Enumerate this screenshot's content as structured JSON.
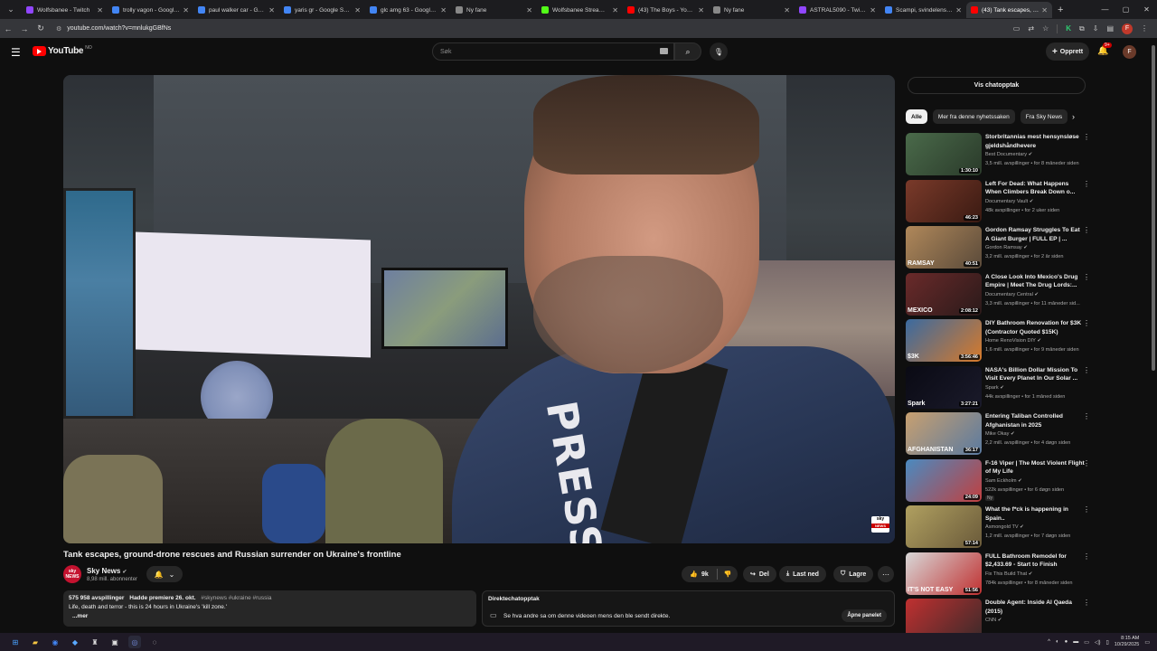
{
  "browser": {
    "tabs": [
      {
        "title": "Wolfsbanee - Twitch",
        "color": "#9146ff"
      },
      {
        "title": "trolly vagon - Google Search",
        "color": "#4285f4"
      },
      {
        "title": "paul walker car - Google Search",
        "color": "#4285f4"
      },
      {
        "title": "yaris gr - Google Search",
        "color": "#4285f4"
      },
      {
        "title": "glc amg 63 - Google Search",
        "color": "#4285f4"
      },
      {
        "title": "Ny fane",
        "color": "#888888"
      },
      {
        "title": "Wolfsbanee Stream - Kick",
        "color": "#53fc18"
      },
      {
        "title": "(43) The Boys - YouTube",
        "color": "#ff0000"
      },
      {
        "title": "Ny fane",
        "color": "#888888"
      },
      {
        "title": "ASTRAL5090 - Twitch",
        "color": "#9146ff"
      },
      {
        "title": "Scampi, svindelens opp...",
        "color": "#4285f4"
      },
      {
        "title": "(43) Tank escapes, gro...",
        "color": "#ff0000",
        "active": true
      }
    ],
    "url": "youtube.com/watch?v=mnlukgGBfNs",
    "profile_letter": "F"
  },
  "youtube": {
    "logo_word": "YouTube",
    "region": "NO",
    "search_placeholder": "Søk",
    "create_label": "Opprett",
    "notif_count": "9+",
    "avatar_letter": "F"
  },
  "video": {
    "title": "Tank escapes, ground-drone rescues and Russian surrender on Ukraine's frontline",
    "channel": "Sky News",
    "subscribers": "8,98 mill. abonnenter",
    "likes": "9k",
    "share_label": "Del",
    "download_label": "Last ned",
    "save_label": "Lagre",
    "watermark_top": "sky",
    "watermark_bottom": "NEWS",
    "press_text": "PRESS"
  },
  "description": {
    "views": "575 958 avspillinger",
    "premiere": "Hadde premiere 26. okt.",
    "tags": "#skynews #ukraine #russia",
    "line2": "Life, death and terror - this is 24 hours in Ukraine's 'kill zone.'",
    "more": "...mer"
  },
  "livechat": {
    "heading": "Direktechatopptak",
    "message": "Se hva andre sa om denne videoen mens den ble sendt direkte.",
    "open_label": "Åpne panelet"
  },
  "sidebar": {
    "chat_replay": "Vis chatopptak",
    "chips": [
      "Alle",
      "Mer fra denne nyhetssaken",
      "Fra Sky News"
    ],
    "recommendations": [
      {
        "title": "Storbritannias mest hensynsløse gjeldshåndhevere",
        "channel": "Best Documentary",
        "stats": "3,5 mill. avspillinger • for 8 måneder siden",
        "duration": "1:30:10",
        "c1": "#4a6a4a",
        "c2": "#2a3a2a"
      },
      {
        "title": "Left For Dead: What Happens When Climbers Break Down o...",
        "channel": "Documentary Vault",
        "stats": "48k avspillinger • for 2 uker siden",
        "duration": "46:23",
        "c1": "#7a3a2a",
        "c2": "#3a1a12"
      },
      {
        "title": "Gordon Ramsay Struggles To Eat A Giant Burger | FULL EP | ...",
        "channel": "Gordon Ramsay",
        "stats": "3,2 mill. avspillinger • for 2 år siden",
        "duration": "40:51",
        "c1": "#b0885a",
        "c2": "#5a4a3a",
        "label": "RAMSAY"
      },
      {
        "title": "A Close Look Into Mexico's Drug Empire | Meet The Drug Lords:...",
        "channel": "Documentary Central",
        "stats": "3,3 mill. avspillinger • for 11 måneder sid...",
        "duration": "2:08:12",
        "c1": "#6a2a2a",
        "c2": "#2a1a1a",
        "label": "MEXICO"
      },
      {
        "title": "DIY Bathroom Renovation for $3K (Contractor Quoted $15K)",
        "channel": "Home RenoVision DIY",
        "stats": "1,6 mill. avspillinger • for 9 måneder siden",
        "duration": "3:56:46",
        "c1": "#3a6aa0",
        "c2": "#d87a2a",
        "label": "$3K"
      },
      {
        "title": "NASA's Billion Dollar Mission To Visit Every Planet In Our Solar ...",
        "channel": "Spark",
        "stats": "44k avspillinger • for 1 måned siden",
        "duration": "3:27:21",
        "c1": "#0a0a14",
        "c2": "#1a1a2a",
        "label": "Spark"
      },
      {
        "title": "Entering Taliban Controlled Afghanistan in 2025",
        "channel": "Mike Okay",
        "stats": "2,2 mill. avspillinger • for 4 døgn siden",
        "duration": "36:17",
        "c1": "#c8a070",
        "c2": "#5a7aa0",
        "label": "AFGHANISTAN"
      },
      {
        "title": "F-16 Viper | The Most Violent Flight of My Life",
        "channel": "Sam Eckholm",
        "stats": "522k avspillinger • for 6 døgn siden",
        "duration": "24:09",
        "c1": "#4a8ac0",
        "c2": "#c04040",
        "new": "Ny"
      },
      {
        "title": "What the f*ck is happening in Spain..",
        "channel": "Asmongold TV",
        "stats": "1,2 mill. avspillinger • for 7 døgn siden",
        "duration": "57:14",
        "c1": "#b0a060",
        "c2": "#6a5a3a"
      },
      {
        "title": "FULL Bathroom Remodel for $2,433.69 - Start to Finish",
        "channel": "Fix This Build That",
        "stats": "784k avspillinger • for 8 måneder siden",
        "duration": "51:56",
        "c1": "#d8d8d8",
        "c2": "#c03030",
        "label": "IT'S NOT EASY"
      },
      {
        "title": "Double Agent: Inside Al Qaeda (2015)",
        "channel": "CNN",
        "stats": "",
        "duration": "",
        "c1": "#c03030",
        "c2": "#3a2a2a"
      }
    ]
  },
  "taskbar": {
    "time": "8:15 AM",
    "date": "10/29/2025"
  }
}
